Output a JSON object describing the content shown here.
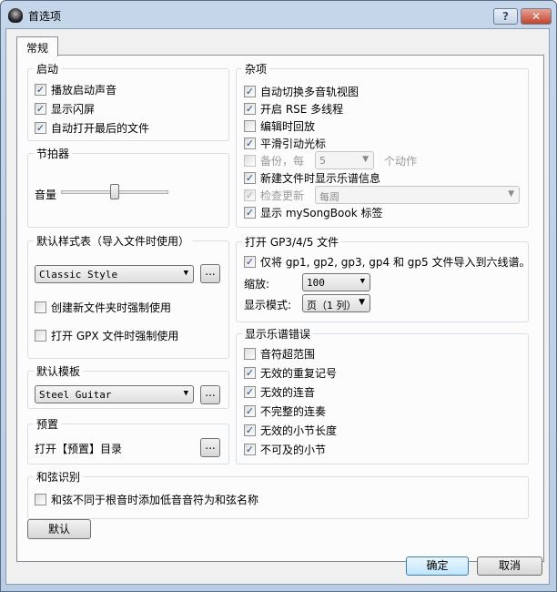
{
  "window": {
    "title": "首选项",
    "help": "?",
    "close": "✕"
  },
  "tab": "常规",
  "startup": {
    "title": "启动",
    "items": [
      {
        "label": "播放启动声音",
        "checked": true
      },
      {
        "label": "显示闪屏",
        "checked": true
      },
      {
        "label": "自动打开最后的文件",
        "checked": true
      }
    ]
  },
  "metronome": {
    "title": "节拍器",
    "volume_label": "音量",
    "volume_level": 0.5
  },
  "stylesheet": {
    "title": "默认样式表（导入文件时使用）",
    "value": "Classic Style",
    "browse": "...",
    "force_new": "创建新文件夹时强制使用",
    "force_gpx": "打开 GPX 文件时强制使用"
  },
  "template": {
    "title": "默认模板",
    "value": "Steel Guitar",
    "browse": "..."
  },
  "preset": {
    "title": "预置",
    "label": "打开【预置】目录",
    "browse": "..."
  },
  "misc": {
    "title": "杂项",
    "items": [
      "自动切换多音轨视图",
      "开启 RSE 多线程",
      "编辑时回放",
      "平滑引动光标"
    ],
    "backup_label": "备份，每",
    "backup_value": "5",
    "backup_suffix": "个动作",
    "new_file_info": "新建文件时显示乐谱信息",
    "check_update": "检查更新",
    "update_freq": "每周",
    "show_songbook": "显示 mySongBook 标签"
  },
  "gp": {
    "title": "打开 GP3/4/5 文件",
    "import_tab": "仅将 gp1, gp2, gp3, gp4 和 gp5 文件导入到六线谱。",
    "zoom_label": "缩放:",
    "zoom_value": "100",
    "mode_label": "显示模式:",
    "mode_value": "页（1 列）"
  },
  "errors": {
    "title": "显示乐谱错误",
    "items": [
      {
        "label": "音符超范围",
        "checked": false
      },
      {
        "label": "无效的重复记号",
        "checked": true
      },
      {
        "label": "无效的连音",
        "checked": true
      },
      {
        "label": "不完整的连奏",
        "checked": true
      },
      {
        "label": "无效的小节长度",
        "checked": true
      },
      {
        "label": "不可及的小节",
        "checked": true
      }
    ]
  },
  "chord": {
    "title": "和弦识别",
    "bass": "和弦不同于根音时添加低音音符为和弦名称"
  },
  "buttons": {
    "default": "默认",
    "ok": "确定",
    "cancel": "取消"
  },
  "check": "✓"
}
